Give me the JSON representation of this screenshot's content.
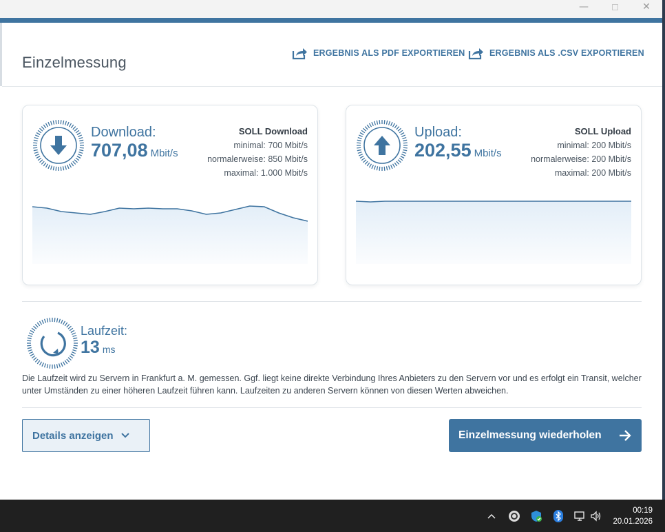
{
  "window": {
    "controls": {
      "minimize": "—",
      "maximize": "",
      "close": "✕"
    }
  },
  "header": {
    "title": "Einzelmessung",
    "export_pdf": "ERGEBNIS ALS PDF EXPORTIEREN",
    "export_csv": "ERGEBNIS ALS .CSV EXPORTIEREN"
  },
  "download": {
    "label": "Download:",
    "value": "707,08",
    "unit": "Mbit/s",
    "soll_title": "SOLL Download",
    "minimal": "minimal: 700 Mbit/s",
    "normal": "normalerweise: 850 Mbit/s",
    "maximal": "maximal: 1.000 Mbit/s",
    "icon": "arrow-down-icon"
  },
  "upload": {
    "label": "Upload:",
    "value": "202,55",
    "unit": "Mbit/s",
    "soll_title": "SOLL Upload",
    "minimal": "minimal: 200 Mbit/s",
    "normal": "normalerweise: 200 Mbit/s",
    "maximal": "maximal: 200 Mbit/s",
    "icon": "arrow-up-icon"
  },
  "latency": {
    "label": "Laufzeit:",
    "value": "13",
    "unit": "ms",
    "info": "Die Laufzeit wird zu Servern in Frankfurt a. M. gemessen. Ggf. liegt keine direkte Verbindung Ihres Anbieters zu den Servern vor und es erfolgt ein Transit, welcher unter Umständen zu einer höheren Laufzeit führen kann. Laufzeiten zu anderen Servern können von diesen Werten abweichen."
  },
  "actions": {
    "details": "Details anzeigen",
    "repeat": "Einzelmessung wiederholen"
  },
  "taskbar": {
    "time": "00:19",
    "date": "20.01.2026",
    "icons": [
      "chevron-up-icon",
      "copilot-icon",
      "defender-icon",
      "bluetooth-icon",
      "network-icon",
      "volume-icon"
    ]
  },
  "colors": {
    "accent": "#3f74a0",
    "chart_fill": "#e3eef8"
  },
  "chart_data": [
    {
      "type": "area",
      "series": [
        {
          "values": [
            0.83,
            0.81,
            0.76,
            0.74,
            0.72,
            0.76,
            0.81,
            0.8,
            0.81,
            0.8,
            0.8,
            0.77,
            0.72,
            0.74,
            0.79,
            0.84,
            0.83,
            0.74,
            0.67,
            0.62
          ]
        }
      ]
    },
    {
      "type": "area",
      "series": [
        {
          "values": [
            0.91,
            0.9,
            0.91,
            0.91,
            0.91,
            0.91,
            0.91,
            0.91,
            0.91,
            0.91,
            0.91,
            0.91,
            0.91,
            0.91,
            0.91,
            0.91,
            0.91,
            0.91,
            0.91,
            0.91
          ]
        }
      ]
    }
  ]
}
